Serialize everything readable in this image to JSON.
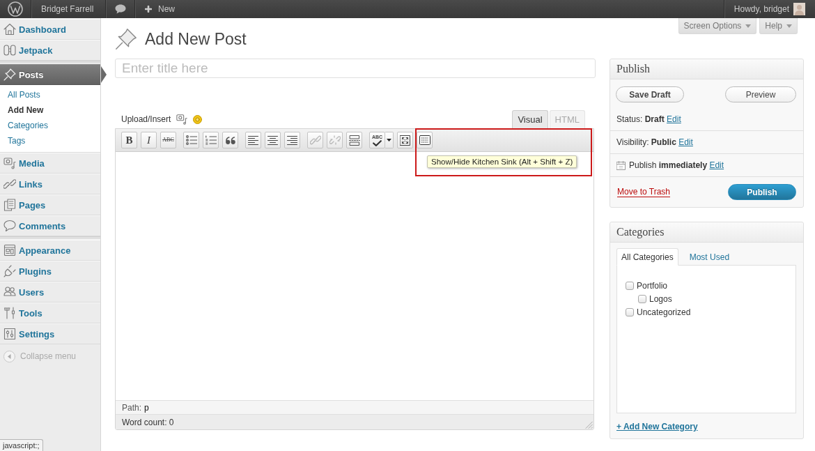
{
  "admin_bar": {
    "site_name": "Bridget Farrell",
    "new_label": "New",
    "greeting": "Howdy, bridget"
  },
  "sidebar": {
    "groups": [
      {
        "items": [
          {
            "label": "Dashboard",
            "selected": false
          },
          {
            "label": "Jetpack",
            "selected": false
          }
        ]
      },
      {
        "items": [
          {
            "label": "Posts",
            "selected": true,
            "children": [
              {
                "label": "All Posts",
                "selected": false
              },
              {
                "label": "Add New",
                "selected": true
              },
              {
                "label": "Categories",
                "selected": false
              },
              {
                "label": "Tags",
                "selected": false
              }
            ]
          },
          {
            "label": "Media",
            "selected": false
          },
          {
            "label": "Links",
            "selected": false
          },
          {
            "label": "Pages",
            "selected": false
          },
          {
            "label": "Comments",
            "selected": false
          }
        ]
      },
      {
        "items": [
          {
            "label": "Appearance",
            "selected": false
          },
          {
            "label": "Plugins",
            "selected": false
          },
          {
            "label": "Users",
            "selected": false
          },
          {
            "label": "Tools",
            "selected": false
          },
          {
            "label": "Settings",
            "selected": false
          }
        ]
      }
    ],
    "collapse": "Collapse menu"
  },
  "screen_meta": [
    {
      "label": "Screen Options"
    },
    {
      "label": "Help"
    }
  ],
  "page_title": "Add New Post",
  "title_field": {
    "placeholder": "Enter title here"
  },
  "editor": {
    "upload_label": "Upload/Insert",
    "tabs": [
      {
        "label": "Visual",
        "selected": true
      },
      {
        "label": "HTML",
        "selected": false
      }
    ],
    "toolbar": [
      {
        "buttons": [
          {
            "kind": "bold",
            "label": "B",
            "disabled": false
          },
          {
            "kind": "italic",
            "label": "I",
            "disabled": false
          },
          {
            "kind": "strike",
            "label": "ABC",
            "disabled": false
          }
        ]
      },
      {
        "buttons": [
          {
            "kind": "bullets",
            "disabled": false
          },
          {
            "kind": "numbers",
            "disabled": false
          },
          {
            "kind": "quote",
            "disabled": false
          }
        ]
      },
      {
        "buttons": [
          {
            "kind": "alignleft",
            "disabled": false
          },
          {
            "kind": "aligncenter",
            "disabled": false
          },
          {
            "kind": "alignright",
            "disabled": false
          }
        ]
      },
      {
        "buttons": [
          {
            "kind": "link",
            "disabled": true
          },
          {
            "kind": "unlink",
            "disabled": true
          },
          {
            "kind": "more",
            "disabled": false
          }
        ]
      },
      {
        "buttons": [
          {
            "kind": "spellcheck",
            "label": "ABC",
            "disabled": false
          },
          {
            "kind": "fullscreen",
            "disabled": false
          },
          {
            "kind": "kitchensink",
            "disabled": false
          }
        ]
      }
    ],
    "tooltip": "Show/Hide Kitchen Sink (Alt + Shift + Z)",
    "path_label": "Path:",
    "path": "p",
    "word_count": "Word count: 0"
  },
  "publish": {
    "title": "Publish",
    "save_draft": "Save Draft",
    "preview": "Preview",
    "rows": [
      {
        "kind": "status",
        "text": "Status: **Draft**",
        "link": "Edit"
      },
      {
        "kind": "visibility",
        "text": "Visibility: **Public**",
        "link": "Edit"
      },
      {
        "kind": "schedule",
        "text": "Publish **immediately**",
        "link": "Edit"
      }
    ],
    "trash": "Move to Trash",
    "publish_button": "Publish"
  },
  "categories": {
    "title": "Categories",
    "tabs": [
      {
        "label": "All Categories",
        "selected": true
      },
      {
        "label": "Most Used",
        "selected": false
      }
    ],
    "items": [
      {
        "label": "Portfolio",
        "checked": false,
        "children": [
          {
            "label": "Logos",
            "checked": false
          }
        ]
      },
      {
        "label": "Uncategorized",
        "checked": false
      }
    ],
    "add_link": "+ Add New Category"
  },
  "status_bar": "javascript:;"
}
